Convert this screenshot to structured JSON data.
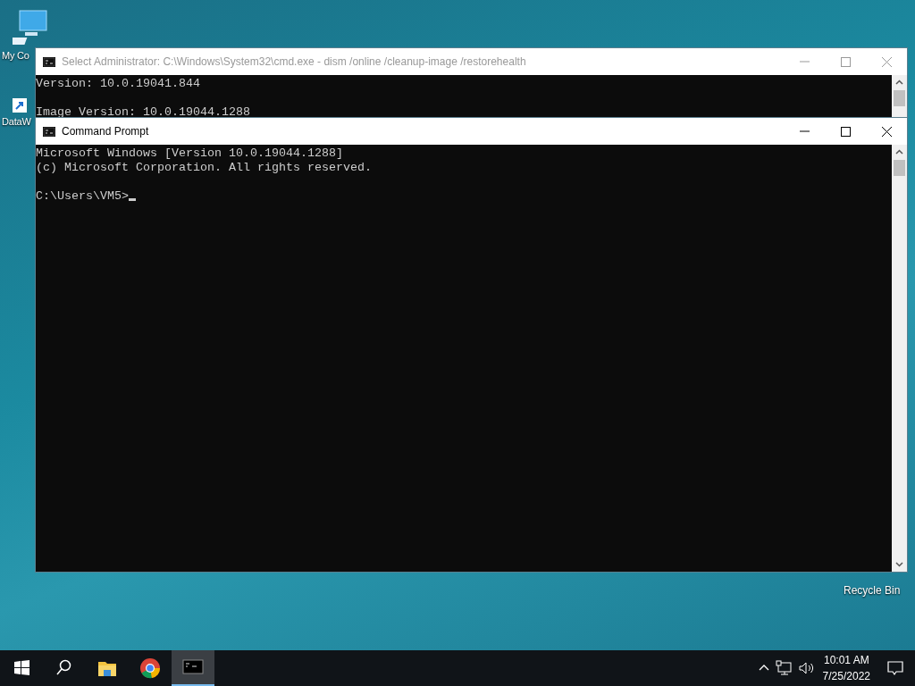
{
  "desktop_icons": [
    {
      "kind": "computer",
      "label": "My Co"
    },
    {
      "kind": "shortcut",
      "label": "DataW"
    },
    {
      "kind": "recycle",
      "label": "Recycle Bin"
    }
  ],
  "windows": [
    {
      "title": "Select Administrator: C:\\Windows\\System32\\cmd.exe - dism  /online /cleanup-image /restorehealth",
      "active": false,
      "cursor": false,
      "paragraphs": [
        [
          "Version: 10.0.19041.844"
        ],
        [
          "Image Version: 10.0.19044.1288"
        ]
      ]
    },
    {
      "title": "Command Prompt",
      "active": true,
      "cursor": true,
      "paragraphs": [
        [
          "Microsoft Windows [Version 10.0.19044.1288]",
          "(c) Microsoft Corporation. All rights reserved."
        ],
        [
          "C:\\Users\\VM5>"
        ]
      ]
    }
  ],
  "taskbar": {
    "buttons": [
      {
        "kind": "start",
        "selected": false
      },
      {
        "kind": "search",
        "selected": false
      },
      {
        "kind": "folder",
        "selected": false
      },
      {
        "kind": "browser",
        "selected": false
      },
      {
        "kind": "console",
        "selected": true
      }
    ],
    "time": "10:01 AM",
    "date": "7/25/2022"
  }
}
